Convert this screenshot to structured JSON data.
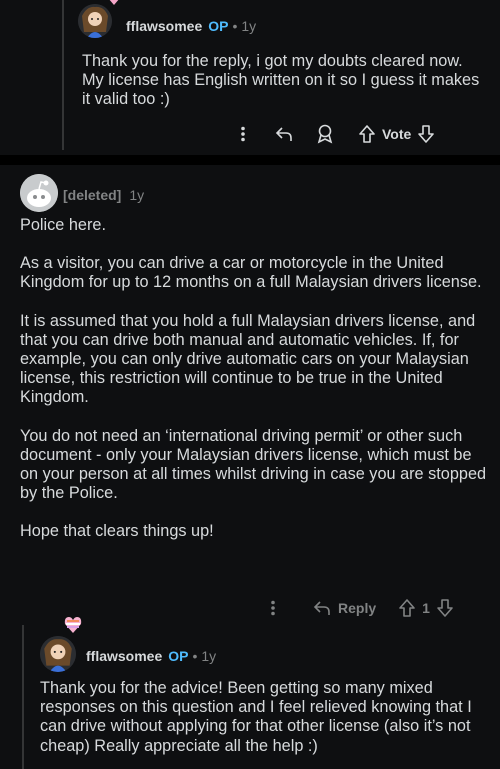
{
  "comment1": {
    "author": "fflawsomee",
    "op_badge": "OP",
    "age": "1y",
    "text": "Thank you for the reply, i got my doubts cleared now. My license has English written on it so I guess it makes it valid too :)",
    "vote_label": "Vote"
  },
  "comment2": {
    "author": "[deleted]",
    "age": "1y",
    "paragraphs": [
      "Police here.",
      "As a visitor, you can drive a car or motorcycle in the United Kingdom for up to 12 months on a full Malaysian drivers license.",
      "It is assumed that you hold a full Malaysian drivers license, and that you can drive both manual and automatic vehicles. If, for example, you can only drive automatic cars on your Malaysian license, this restriction will continue to be true in the United Kingdom.",
      "You do not need an ‘international driving permit’ or other such document - only your Malaysian drivers license, which must be on your person at all times whilst driving in case you are stopped by the Police.",
      "Hope that clears things up!"
    ],
    "reply_label": "Reply",
    "vote_count": "1"
  },
  "comment3": {
    "author": "fflawsomee",
    "op_badge": "OP",
    "age": "1y",
    "text": "Thank you for the advice! Been getting so many mixed responses on this question and I feel relieved knowing that I can drive without applying for that other license (also it’s not cheap) Really appreciate all the help :)"
  },
  "colors": {
    "background": "#0e0f11",
    "op_badge": "#4fbcff",
    "meta": "#818384",
    "text": "#d7dadc"
  }
}
